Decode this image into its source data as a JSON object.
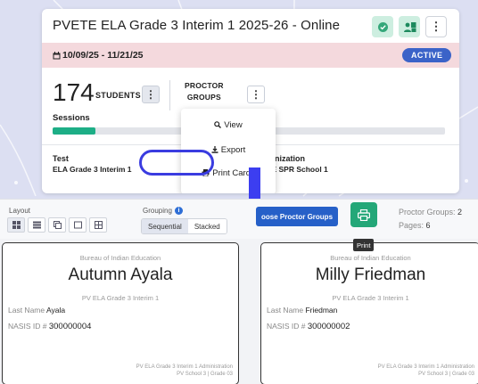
{
  "colors": {
    "accent_blue": "#3b63c8",
    "highlight_ring": "#3a3ce0",
    "arrow": "#3c3ef0",
    "progress_green": "#1dae86",
    "print_green": "#24a778",
    "date_band": "#f4d9dd"
  },
  "session": {
    "title": "PVETE ELA Grade 3 Interim 1 2025-26 - Online",
    "date_range": "10/09/25 - 11/21/25",
    "status": "ACTIVE",
    "student_count": "174",
    "students_label": "STUDENTS",
    "proctor_groups_label_1": "PROCTOR",
    "proctor_groups_label_2": "GROUPS",
    "sessions_label": "Sessions",
    "sessions_progress": 0.11,
    "test_label": "Test",
    "test_value": "ELA Grade 3 Interim 1",
    "org_label": "Organization",
    "org_value": "PVBE SPR School 1"
  },
  "menu": {
    "items": [
      "View",
      "Export",
      "Print Cards"
    ]
  },
  "toolbar": {
    "layout_label": "Layout",
    "grouping_label": "Grouping",
    "grouping_options": [
      "Sequential",
      "Stacked"
    ],
    "choose_button": "oose Proctor Groups",
    "tooltip": "Print",
    "proctor_groups_text": "Proctor Groups:",
    "proctor_groups_value": "2",
    "pages_text": "Pages:",
    "pages_value": "6"
  },
  "cards": [
    {
      "bureau": "Bureau of Indian Education",
      "name": "Autumn Ayala",
      "test": "PV ELA Grade 3 Interim 1",
      "last_name_label": "Last Name",
      "last_name": "Ayala",
      "nasis_label": "NASIS ID #",
      "nasis_id": "300000004",
      "admin": "PV ELA Grade 3 Interim 1 Administration",
      "school": "PV School 3 | Grade 03"
    },
    {
      "bureau": "Bureau of Indian Education",
      "name": "Milly Friedman",
      "test": "PV ELA Grade 3 Interim 1",
      "last_name_label": "Last Name",
      "last_name": "Friedman",
      "nasis_label": "NASIS ID #",
      "nasis_id": "300000002",
      "admin": "PV ELA Grade 3 Interim 1 Administration",
      "school": "PV School 3 | Grade 03"
    }
  ]
}
